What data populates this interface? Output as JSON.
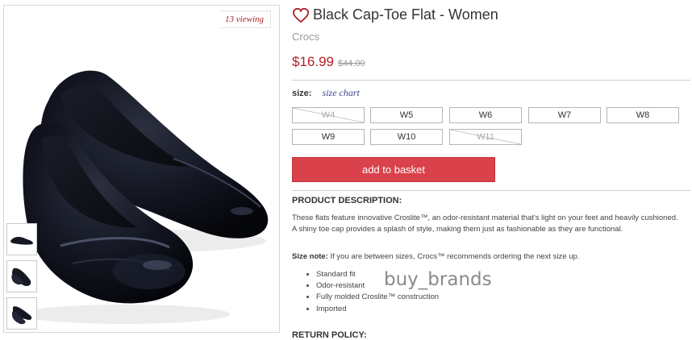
{
  "gallery": {
    "viewing_tag": "13 viewing",
    "main_image_icon": "black-flat-shoe-image",
    "thumbnails": [
      "shoe-side-view-thumb",
      "shoe-top-view-thumb",
      "shoe-pair-thumb"
    ]
  },
  "product": {
    "title": "Black Cap-Toe Flat - Women",
    "brand": "Crocs",
    "price": "$16.99",
    "original_price": "$44.00"
  },
  "sizes": {
    "label": "size:",
    "chart_link": "size chart",
    "options": [
      {
        "label": "W4",
        "available": false
      },
      {
        "label": "W5",
        "available": true
      },
      {
        "label": "W6",
        "available": true
      },
      {
        "label": "W7",
        "available": true
      },
      {
        "label": "W8",
        "available": true
      },
      {
        "label": "W9",
        "available": true
      },
      {
        "label": "W10",
        "available": true
      },
      {
        "label": "W11",
        "available": false
      }
    ]
  },
  "basket_button": "add to basket",
  "description": {
    "heading": "PRODUCT DESCRIPTION:",
    "text": "These flats feature innovative Croslite™, an odor-resistant material that's light on your feet and heavily cushioned. A shiny toe cap provides a splash of style, making them just as fashionable as they are functional.",
    "size_note_label": "Size note:",
    "size_note_text": " If you are between sizes, Crocs™ recommends ordering the next size up.",
    "features": [
      "Standard fit",
      "Odor-resistant",
      "Fully molded Croslite™ construction",
      "Imported"
    ]
  },
  "watermark": "buy_brands",
  "return_policy_heading": "RETURN POLICY:",
  "colors": {
    "accent_red": "#b02026",
    "button_red": "#d9424a",
    "link_blue": "#3c3f8e"
  }
}
